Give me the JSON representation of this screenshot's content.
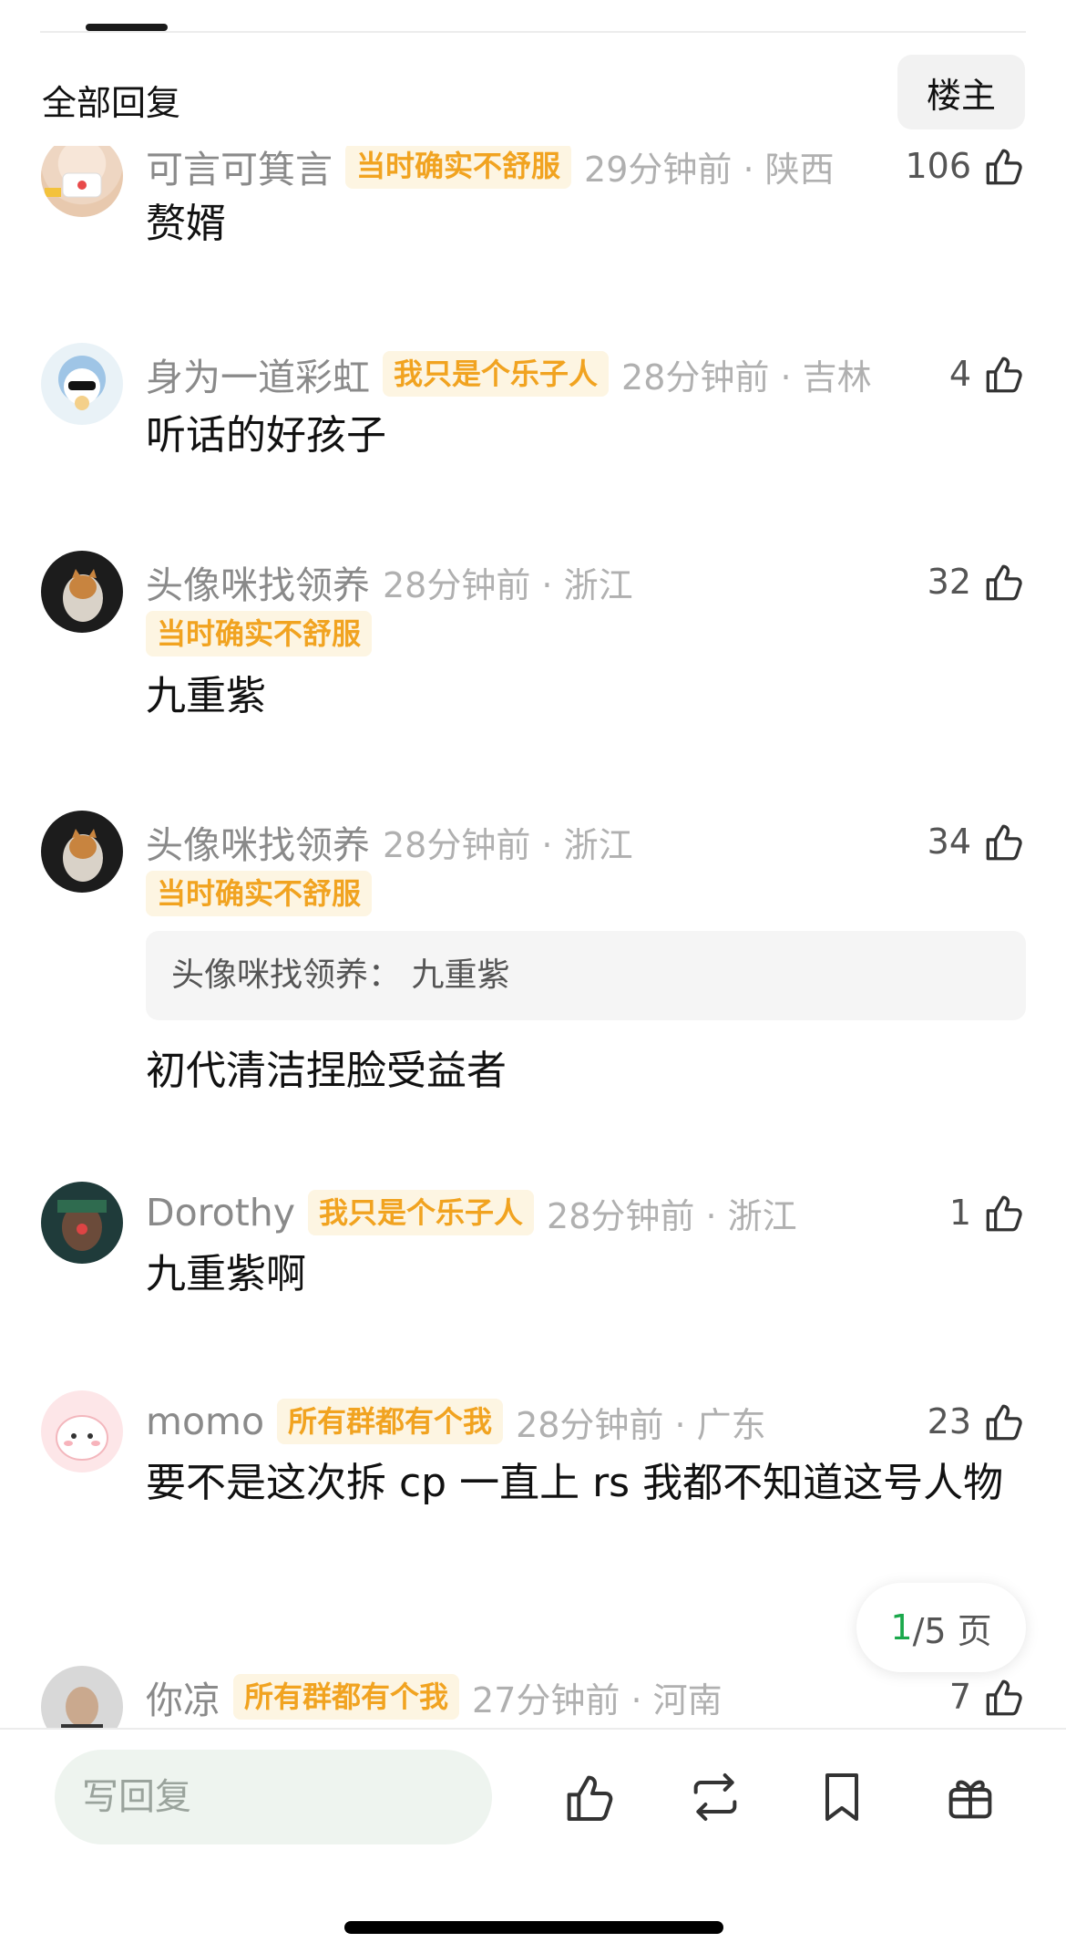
{
  "header": {
    "title": "全部回复",
    "op_label": "楼主"
  },
  "comments": [
    {
      "username": "可言可箕言",
      "badge": "当时确实不舒服",
      "time": "29分钟前 · 陕西",
      "likes": "106",
      "content": "赘婿"
    },
    {
      "username": "身为一道彩虹",
      "badge": "我只是个乐子人",
      "time": "28分钟前 · 吉林",
      "likes": "4",
      "content": "听话的好孩子"
    },
    {
      "username": "头像咪找领养",
      "badge": "当时确实不舒服",
      "time": "28分钟前 · 浙江",
      "likes": "32",
      "content": "九重紫"
    },
    {
      "username": "头像咪找领养",
      "badge": "当时确实不舒服",
      "time": "28分钟前 · 浙江",
      "likes": "34",
      "quote": "头像咪找领养：  九重紫",
      "content": "初代清洁捏脸受益者"
    },
    {
      "username": "Dorothy",
      "badge": "我只是个乐子人",
      "time": "28分钟前 · 浙江",
      "likes": "1",
      "content": "九重紫啊"
    },
    {
      "username": "momo",
      "badge": "所有群都有个我",
      "time": "28分钟前 · 广东",
      "likes": "23",
      "content": "要不是这次拆 cp 一直上 rs 我都不知道这号人物"
    },
    {
      "username": "你凉",
      "badge": "所有群都有个我",
      "time": "27分钟前 · 河南",
      "likes": "7",
      "content": ""
    }
  ],
  "pager": {
    "current": "1",
    "total_text": "/5 页"
  },
  "bottom_bar": {
    "reply_placeholder": "写回复",
    "icons": [
      "like-icon",
      "repost-icon",
      "bookmark-icon",
      "gift-icon"
    ]
  }
}
